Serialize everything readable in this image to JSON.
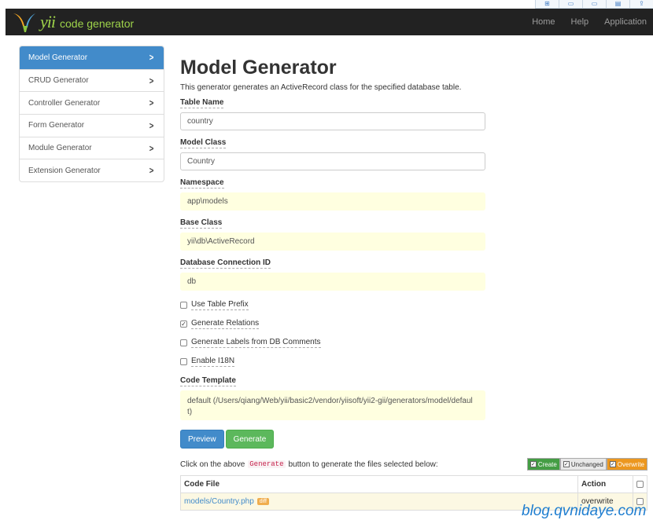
{
  "top_icons": [
    "new-window-icon",
    "window-icon",
    "window-icon",
    "monitor-icon",
    "share-icon"
  ],
  "brand": {
    "logo_word": "yii",
    "title": "code generator",
    "accent": "#9ed34a"
  },
  "nav": {
    "links": [
      {
        "label": "Home"
      },
      {
        "label": "Help"
      },
      {
        "label": "Application"
      }
    ]
  },
  "sidebar": {
    "items": [
      {
        "label": "Model Generator",
        "active": true
      },
      {
        "label": "CRUD Generator"
      },
      {
        "label": "Controller Generator"
      },
      {
        "label": "Form Generator"
      },
      {
        "label": "Module Generator"
      },
      {
        "label": "Extension Generator"
      }
    ]
  },
  "page": {
    "title": "Model Generator",
    "description": "This generator generates an ActiveRecord class for the specified database table."
  },
  "form": {
    "table_name": {
      "label": "Table Name",
      "value": "country"
    },
    "model_class": {
      "label": "Model Class",
      "value": "Country"
    },
    "namespace": {
      "label": "Namespace",
      "value": "app\\models"
    },
    "base_class": {
      "label": "Base Class",
      "value": "yii\\db\\ActiveRecord"
    },
    "db": {
      "label": "Database Connection ID",
      "value": "db"
    },
    "checks": [
      {
        "label": "Use Table Prefix",
        "checked": false
      },
      {
        "label": "Generate Relations",
        "checked": true
      },
      {
        "label": "Generate Labels from DB Comments",
        "checked": false
      },
      {
        "label": "Enable I18N",
        "checked": false
      }
    ],
    "template": {
      "label": "Code Template",
      "value_line1": "default (/Users/qiang/Web/yii/basic2/vendor/yiisoft/yii2-gii/generators/model/defaul",
      "value_line2": "t)"
    }
  },
  "buttons": {
    "preview": "Preview",
    "generate": "Generate"
  },
  "results": {
    "hint_pre": "Click on the above",
    "hint_kw": "Generate",
    "hint_post": "button to generate the files selected below:",
    "legend": {
      "create": "Create",
      "unchanged": "Unchanged",
      "overwrite": "Overwrite"
    },
    "columns": {
      "file": "Code File",
      "action": "Action"
    },
    "rows": [
      {
        "file": "models/Country.php",
        "badge": "diff",
        "action": "overwrite"
      }
    ]
  },
  "watermark": "blog.qvnidaye.com"
}
